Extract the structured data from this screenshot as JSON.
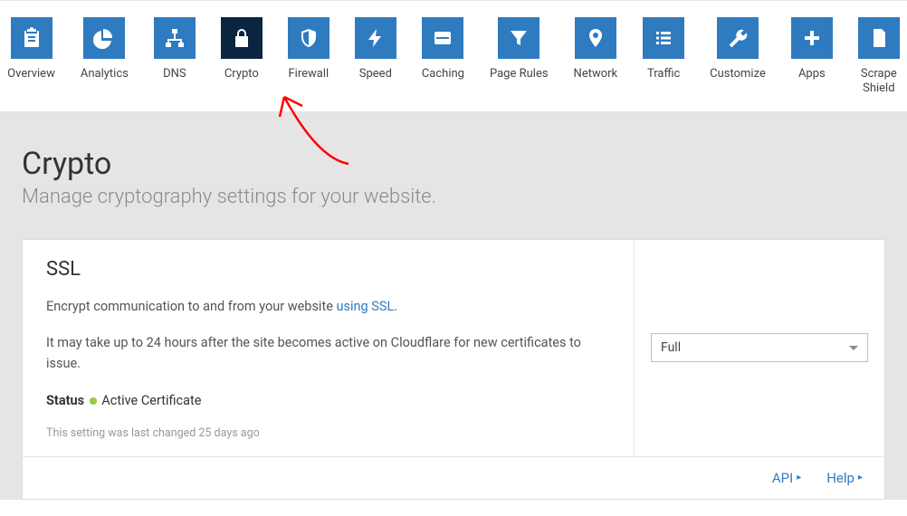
{
  "nav": [
    {
      "id": "overview",
      "label": "Overview",
      "icon": "clipboard"
    },
    {
      "id": "analytics",
      "label": "Analytics",
      "icon": "pie"
    },
    {
      "id": "dns",
      "label": "DNS",
      "icon": "sitemap"
    },
    {
      "id": "crypto",
      "label": "Crypto",
      "icon": "lock",
      "active": true
    },
    {
      "id": "firewall",
      "label": "Firewall",
      "icon": "shield"
    },
    {
      "id": "speed",
      "label": "Speed",
      "icon": "bolt"
    },
    {
      "id": "caching",
      "label": "Caching",
      "icon": "drive"
    },
    {
      "id": "pagerules",
      "label": "Page Rules",
      "icon": "funnel"
    },
    {
      "id": "network",
      "label": "Network",
      "icon": "pin"
    },
    {
      "id": "traffic",
      "label": "Traffic",
      "icon": "list"
    },
    {
      "id": "customize",
      "label": "Customize",
      "icon": "wrench"
    },
    {
      "id": "apps",
      "label": "Apps",
      "icon": "plus"
    },
    {
      "id": "scrape",
      "label": "Scrape\nShield",
      "icon": "doc"
    }
  ],
  "page": {
    "title": "Crypto",
    "subtitle": "Manage cryptography settings for your website."
  },
  "ssl": {
    "title": "SSL",
    "desc_pre": "Encrypt communication to and from your website ",
    "desc_link": "using SSL",
    "desc_post": ".",
    "note": "It may take up to 24 hours after the site becomes active on Cloudflare for new certificates to issue.",
    "status_label": "Status",
    "status_value": "Active Certificate",
    "meta": "This setting was last changed 25 days ago",
    "select_value": "Full"
  },
  "footer": {
    "api": "API",
    "help": "Help"
  }
}
